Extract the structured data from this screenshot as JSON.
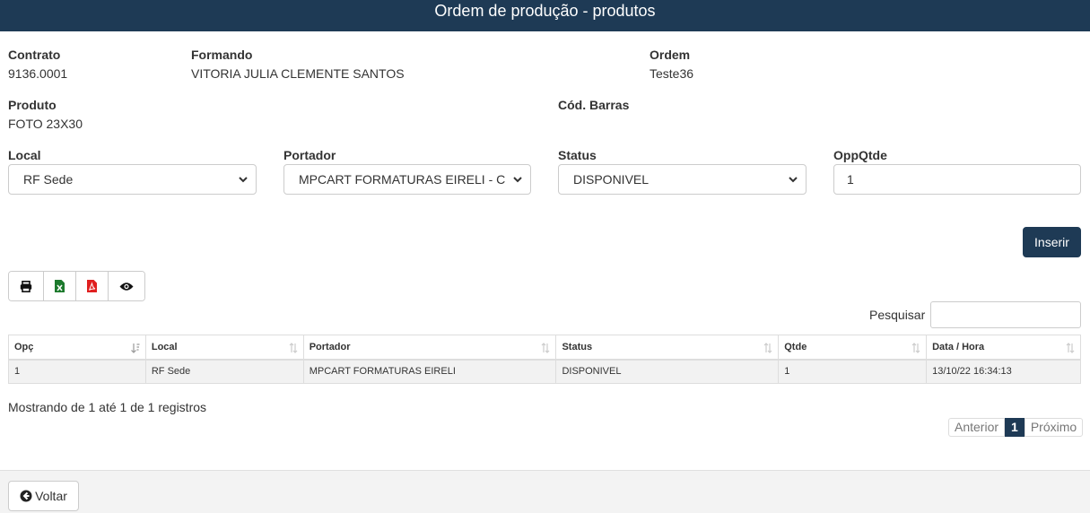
{
  "header": {
    "title": "Ordem de produção - produtos"
  },
  "info": {
    "contrato_label": "Contrato",
    "contrato_value": "9136.0001",
    "formando_label": "Formando",
    "formando_value": "VITORIA JULIA CLEMENTE SANTOS",
    "ordem_label": "Ordem",
    "ordem_value": "Teste36",
    "produto_label": "Produto",
    "produto_value": "FOTO 23X30",
    "codbarras_label": "Cód. Barras"
  },
  "form": {
    "local_label": "Local",
    "local_value": "RF Sede",
    "portador_label": "Portador",
    "portador_value": "MPCART FORMATURAS EIRELI - C",
    "status_label": "Status",
    "status_value": "DISPONIVEL",
    "oppqtde_label": "OppQtde",
    "oppqtde_value": "1",
    "insert_label": "Inserir"
  },
  "toolbar": {
    "icons": [
      "print-icon",
      "excel-icon",
      "pdf-icon",
      "eye-icon"
    ]
  },
  "search": {
    "label": "Pesquisar",
    "value": ""
  },
  "table": {
    "columns": [
      "Opç",
      "Local",
      "Portador",
      "Status",
      "Qtde",
      "Data / Hora"
    ],
    "rows": [
      [
        "1",
        "RF Sede",
        "MPCART FORMATURAS EIRELI",
        "DISPONIVEL",
        "1",
        "13/10/22 16:34:13"
      ]
    ]
  },
  "footer_info": "Mostrando de 1 até 1 de 1 registros",
  "pagination": {
    "prev": "Anterior",
    "current": "1",
    "next": "Próximo"
  },
  "footer": {
    "back_label": "Voltar"
  },
  "colors": {
    "primary": "#1e3a55",
    "excel": "#1d7a2d",
    "pdf": "#e02020"
  }
}
